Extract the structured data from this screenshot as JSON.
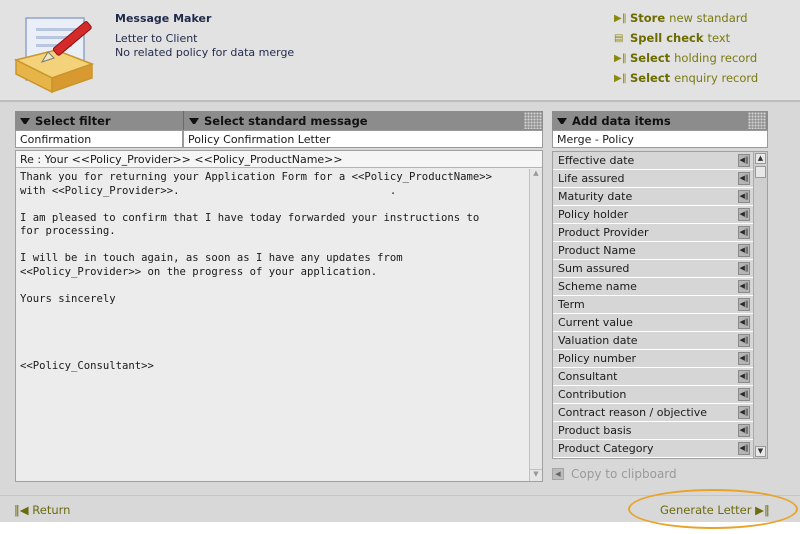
{
  "header": {
    "title": "Message Maker",
    "subtitle1": "Letter to Client",
    "subtitle2": "No related policy for data merge",
    "actions": [
      {
        "bold": "Store",
        "text": "new standard",
        "icon": "arrow-right-icon"
      },
      {
        "bold": "Spell check",
        "text": "text",
        "icon": "document-icon"
      },
      {
        "bold": "Select",
        "text": "holding record",
        "icon": "arrow-right-icon"
      },
      {
        "bold": "Select",
        "text": "enquiry record",
        "icon": "arrow-right-icon"
      }
    ]
  },
  "filter": {
    "header": "Select filter",
    "value": "Confirmation"
  },
  "message": {
    "header": "Select standard message",
    "value": "Policy Confirmation Letter"
  },
  "editor": {
    "subject": "Re : Your <<Policy_Provider>> <<Policy_ProductName>>",
    "body": "Thank you for returning your Application Form for a <<Policy_ProductName>>\nwith <<Policy_Provider>>.                                 .\n\nI am pleased to confirm that I have today forwarded your instructions to\nfor processing.\n\nI will be in touch again, as soon as I have any updates from\n<<Policy_Provider>> on the progress of your application.\n\nYours sincerely\n\n\n\n\n<<Policy_Consultant>>"
  },
  "data_items": {
    "header": "Add data items",
    "merge_value": "Merge - Policy",
    "items": [
      "Effective date",
      "Life assured",
      "Maturity date",
      "Policy holder",
      "Product Provider",
      "Product Name",
      "Sum assured",
      "Scheme name",
      "Term",
      "Current value",
      "Valuation date",
      "Policy number",
      "Consultant",
      "Contribution",
      "Contract reason / objective",
      "Product basis",
      "Product Category"
    ],
    "copy_label": "Copy to clipboard"
  },
  "footer": {
    "return_label": "Return",
    "generate_label": "Generate Letter"
  },
  "colors": {
    "accent": "#6b6b10",
    "highlight": "#e8a32a",
    "header_bar": "#8c8c8c"
  }
}
